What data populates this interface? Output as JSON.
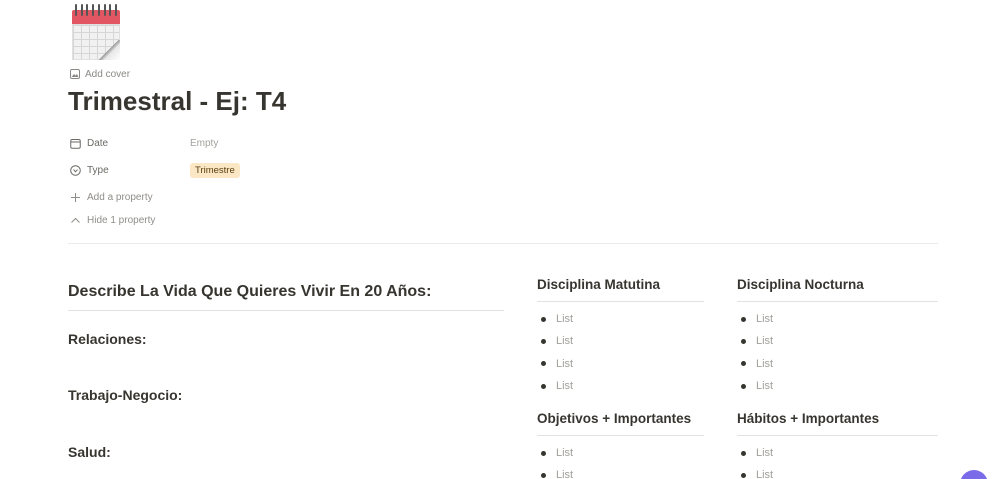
{
  "page": {
    "icon": "calendar-icon",
    "add_cover_label": "Add cover",
    "title": "Trimestral - Ej: T4"
  },
  "properties": {
    "date": {
      "label": "Date",
      "icon": "calendar-small-icon",
      "value": "Empty"
    },
    "type": {
      "label": "Type",
      "icon": "select-icon",
      "value": "Trimestre"
    },
    "add_property": "Add a property",
    "hide_property": "Hide 1 property"
  },
  "left": {
    "heading": "Describe La Vida Que Quieres Vivir En 20 Años:",
    "sections": [
      "Relaciones:",
      "Trabajo-Negocio:",
      "Salud:"
    ]
  },
  "columns": {
    "matutina": {
      "heading": "Disciplina Matutina",
      "items": [
        "List",
        "List",
        "List",
        "List"
      ]
    },
    "nocturna": {
      "heading": "Disciplina Nocturna",
      "items": [
        "List",
        "List",
        "List",
        "List"
      ]
    },
    "objetivos": {
      "heading": "Objetivos + Importantes",
      "items": [
        "List",
        "List"
      ]
    },
    "habitos": {
      "heading": "Hábitos + Importantes",
      "items": [
        "List",
        "List"
      ]
    }
  },
  "colors": {
    "text": "#37352f",
    "tag_bg": "#fbe7c4",
    "calendar_red": "#e25563"
  }
}
